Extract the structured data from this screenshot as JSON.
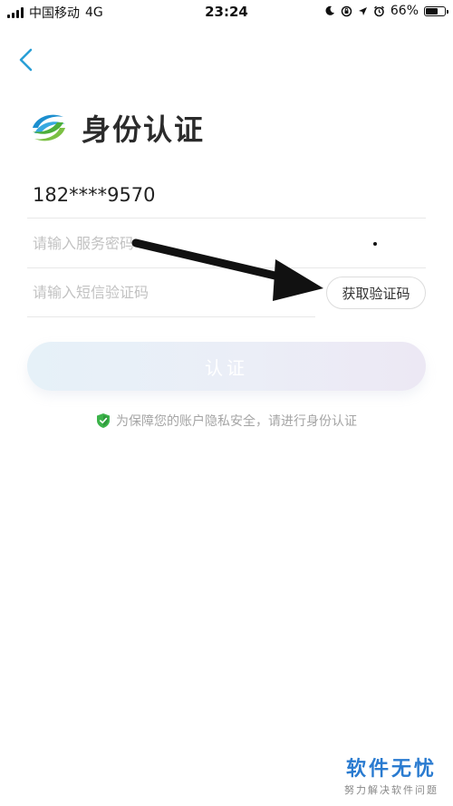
{
  "status_bar": {
    "carrier": "中国移动",
    "network": "4G",
    "time": "23:24",
    "battery_pct": "66%",
    "battery_level": 0.66
  },
  "header": {
    "title": "身份认证"
  },
  "form": {
    "phone_number": "182****9570",
    "password_placeholder": "请输入服务密码",
    "sms_placeholder": "请输入短信验证码",
    "get_code_label": "获取验证码",
    "submit_label": "认证"
  },
  "notice": {
    "text": "为保障您的账户隐私安全，请进行身份认证"
  },
  "watermark": {
    "title": "软件无忧",
    "subtitle": "努力解决软件问题"
  },
  "colors": {
    "accent": "#2a9fd6",
    "shield_green": "#3cb34a",
    "watermark_blue": "#2a7bd0"
  },
  "icons": {
    "back": "chevron-left-icon",
    "logo": "china-mobile-logo",
    "shield": "shield-check-icon"
  }
}
